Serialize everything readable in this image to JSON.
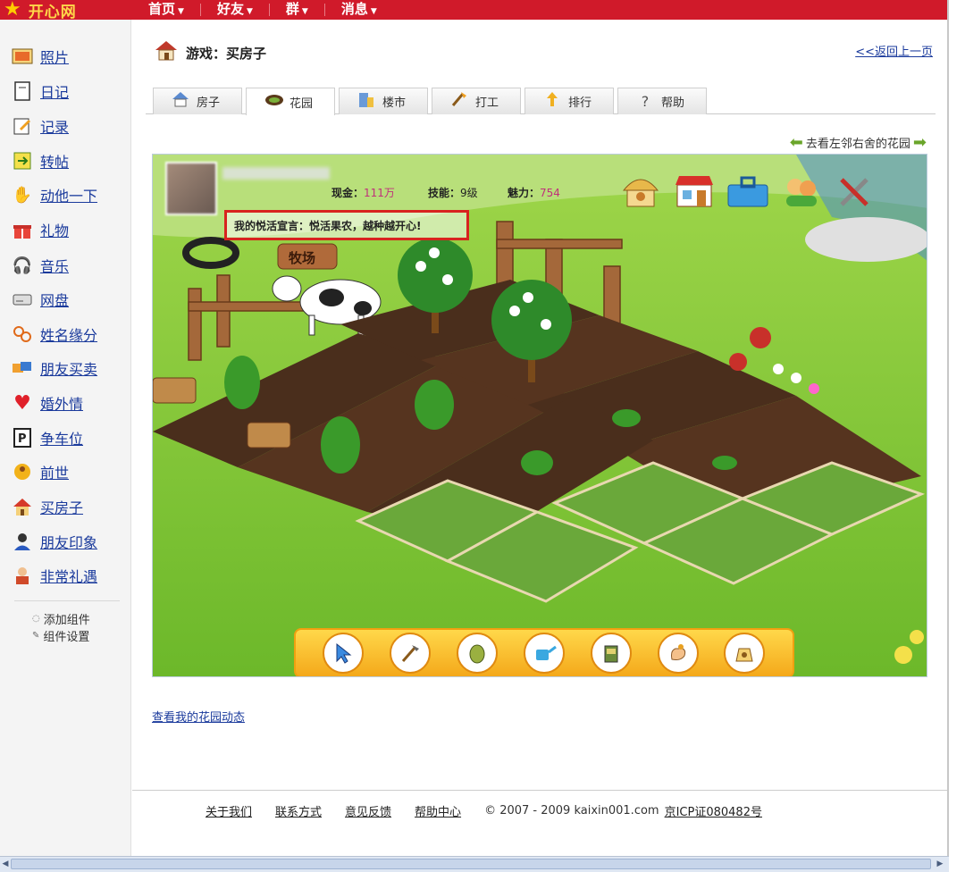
{
  "topbar": {
    "logo_text": "开心网",
    "nav": [
      {
        "label": "首页"
      },
      {
        "label": "好友"
      },
      {
        "label": "群"
      },
      {
        "label": "消息"
      }
    ]
  },
  "sidebar": {
    "items": [
      {
        "label": "照片",
        "icon": "photo-icon"
      },
      {
        "label": "日记",
        "icon": "diary-icon"
      },
      {
        "label": "记录",
        "icon": "record-icon"
      },
      {
        "label": "转帖",
        "icon": "repost-icon"
      },
      {
        "label": "动他一下",
        "icon": "poke-icon"
      },
      {
        "label": "礼物",
        "icon": "gift-icon"
      },
      {
        "label": "音乐",
        "icon": "headphones-icon"
      },
      {
        "label": "网盘",
        "icon": "disk-icon"
      },
      {
        "label": "姓名缘分",
        "icon": "name-fate-icon"
      },
      {
        "label": "朋友买卖",
        "icon": "trade-icon"
      },
      {
        "label": "婚外情",
        "icon": "heart-icon"
      },
      {
        "label": "争车位",
        "icon": "parking-icon"
      },
      {
        "label": "前世",
        "icon": "past-life-icon"
      },
      {
        "label": "买房子",
        "icon": "house-icon"
      },
      {
        "label": "朋友印象",
        "icon": "person-icon"
      },
      {
        "label": "非常礼遇",
        "icon": "gift-person-icon"
      }
    ],
    "add_component": "添加组件",
    "component_settings": "组件设置"
  },
  "main": {
    "title": "游戏：买房子",
    "back_link": "<<返回上一页",
    "tabs": [
      {
        "label": "房子",
        "icon": "house-icon"
      },
      {
        "label": "花园",
        "icon": "garden-icon"
      },
      {
        "label": "楼市",
        "icon": "building-icon"
      },
      {
        "label": "打工",
        "icon": "work-icon"
      },
      {
        "label": "排行",
        "icon": "ranking-icon"
      },
      {
        "label": "帮助",
        "icon": "help-icon"
      }
    ],
    "active_tab": "花园",
    "neighbors_link": "去看左邻右舍的花园",
    "garden_link": "查看我的花园动态"
  },
  "game": {
    "cash_label": "现金：",
    "cash_value": "111万",
    "skill_label": "技能：",
    "skill_value": "9级",
    "charm_label": "魅力：",
    "charm_value": "754",
    "motto": "我的悦活宣言：悦活果农，越种越开心!",
    "farm_sign": "牧场",
    "toolbar": [
      {
        "icon": "cursor-icon"
      },
      {
        "icon": "hoe-icon"
      },
      {
        "icon": "seed-icon"
      },
      {
        "icon": "watering-can-icon"
      },
      {
        "icon": "fertilizer-icon"
      },
      {
        "icon": "harvest-hand-icon"
      },
      {
        "icon": "seed-bag-icon"
      }
    ],
    "top_icons": [
      {
        "icon": "barn-icon"
      },
      {
        "icon": "shop-icon"
      },
      {
        "icon": "toolbox-icon"
      },
      {
        "icon": "friends-icon"
      },
      {
        "icon": "tools-icon"
      }
    ]
  },
  "footer": {
    "links": [
      "关于我们",
      "联系方式",
      "意见反馈",
      "帮助中心"
    ],
    "copyright": "© 2007 - 2009 kaixin001.com",
    "icp": "京ICP证080482号"
  }
}
